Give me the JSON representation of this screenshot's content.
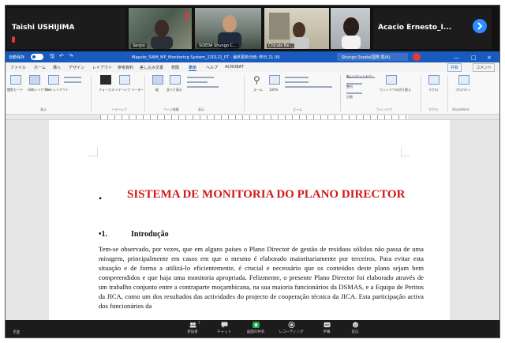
{
  "meeting": {
    "participants": [
      {
        "name": "Taishi USHIJIMA",
        "kind": "name-only",
        "muted": true
      },
      {
        "name": "Sergio",
        "kind": "video",
        "muted": true
      },
      {
        "name": "SOEDA Shungo C...",
        "kind": "video",
        "muted": false
      },
      {
        "name": "Chicale Be...",
        "kind": "video",
        "muted": false
      },
      {
        "name": "Acacio  Ernesto_I...",
        "kind": "name-only",
        "muted": false
      }
    ],
    "toolbar": {
      "leave_label": "Ё送",
      "items": [
        {
          "label": "参加者",
          "icon": "participants-icon",
          "count": "7"
        },
        {
          "label": "チャット",
          "icon": "chat-icon"
        },
        {
          "label": "画面の共有",
          "icon": "share-screen-icon"
        },
        {
          "label": "レコーディング",
          "icon": "record-icon"
        },
        {
          "label": "字幕",
          "icon": "captions-icon"
        },
        {
          "label": "反応",
          "icon": "reactions-icon"
        }
      ]
    }
  },
  "word": {
    "titlebar": {
      "autosave_label": "自動保存",
      "document_name": "Maputo_SWM_MP_Monitoring System_220121_PT - 最終更新日時: 昨日 21:39",
      "search_placeholder": "Shungo Soeda(国際 局/A)",
      "window_controls": [
        "—",
        "□",
        "×"
      ]
    },
    "tabs": [
      "ファイル",
      "ホーム",
      "挿入",
      "デザイン",
      "レイアウト",
      "参考資料",
      "差し込み文書",
      "校閲",
      "表示",
      "ヘルプ",
      "ACROBAT"
    ],
    "active_tab": "表示",
    "share_label": "共有",
    "comments_label": "コメント",
    "ribbon_groups": [
      "表示",
      "イマーシブ",
      "ページ移動",
      "表示",
      "ズーム",
      "ウィンドウ",
      "マクロ",
      "SharePoint"
    ],
    "ribbon_items": [
      "閲覧モード",
      "印刷レイアウト",
      "Web レイアウト",
      "フォーカス",
      "イマーシブ リーダー",
      "縦",
      "並べて表示",
      "ズーム",
      "100%",
      "新しいウィンドウ",
      "整列",
      "分割",
      "ウィンドウの切り替え",
      "マクロ",
      "プロパティ"
    ]
  },
  "document": {
    "bullet": "•",
    "title": "SISTEMA DE MONITORIA DO PLANO DIRECTOR",
    "section_number": "•1.",
    "section_title": "Introdução",
    "paragraph": "Tem-se observado, por vezes, que em alguns países o Plano Director de gestão de resíduos sólidos não passa de uma miragem, principalmente em casos em que o mesmo é elaborado maioritariamente por terceiros. Para evitar esta situação e de forma a utilizá-lo eficientemente, é crucial e necessário que os conteúdos deste plano sejam bem compreendidos e que haja uma monitoria apropriada. Felizmente, o presente Plano Director foi elaborado através de um trabalho conjunto entre a contraparte moçambicana, na sua maioria funcionários da DSMAS, e a Equipa de Peritos da JICA, como um dos resultados das actividades do projecto de cooperação técnica da JICA. Esta participação activa dos funcionários da"
  },
  "colors": {
    "word_blue": "#185abd",
    "title_red": "#d01818",
    "zoom_blue": "#2d8cff",
    "share_green": "#22a94a"
  }
}
